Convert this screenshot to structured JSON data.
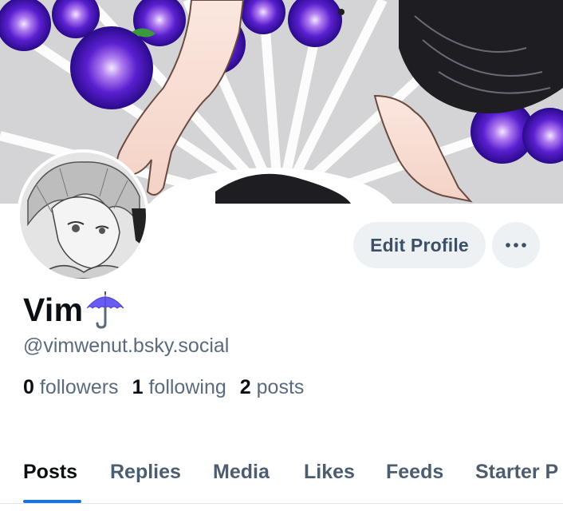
{
  "profile": {
    "display_name": "Vim",
    "name_emoji": "umbrella-icon",
    "handle": "@vimwenut.bsky.social"
  },
  "actions": {
    "edit_profile_label": "Edit Profile",
    "more_icon": "ellipsis-icon"
  },
  "stats": {
    "followers_count": "0",
    "followers_label": "followers",
    "following_count": "1",
    "following_label": "following",
    "posts_count": "2",
    "posts_label": "posts"
  },
  "tabs": [
    {
      "label": "Posts",
      "active": true
    },
    {
      "label": "Replies",
      "active": false
    },
    {
      "label": "Media",
      "active": false
    },
    {
      "label": "Likes",
      "active": false
    },
    {
      "label": "Feeds",
      "active": false
    },
    {
      "label": "Starter P",
      "active": false
    }
  ],
  "colors": {
    "accent": "#1a73d9",
    "button_bg": "#eef1f4",
    "muted_text": "#5b6b7d",
    "banner_flower": "#5a1fd0"
  }
}
